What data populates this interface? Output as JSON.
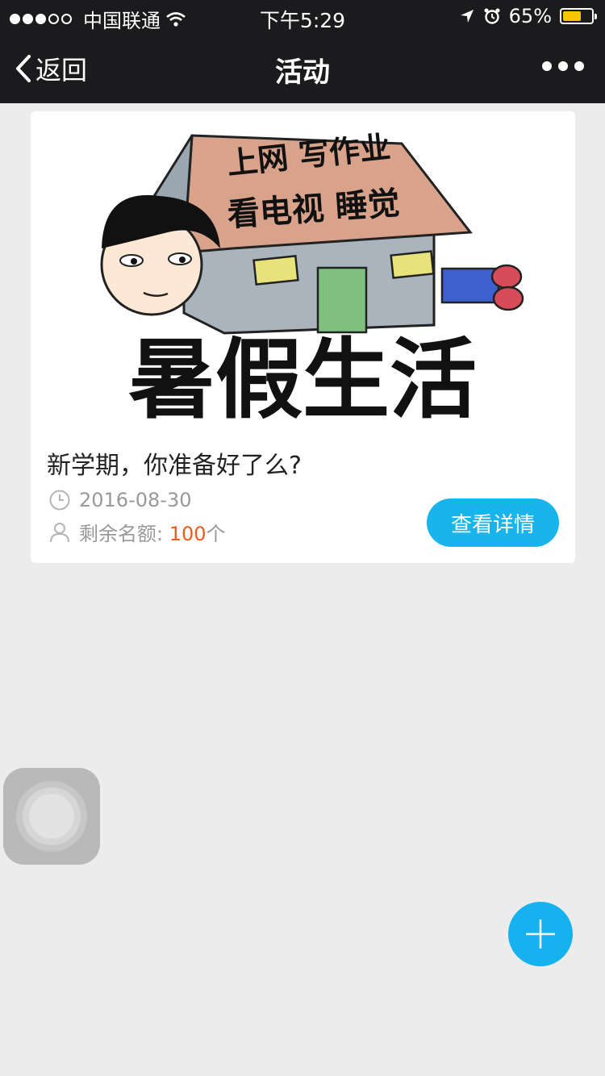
{
  "status_bar": {
    "carrier": "中国联通",
    "time": "下午5:29",
    "battery_percent": "65%",
    "battery_level": 0.65,
    "battery_color": "#f7c600"
  },
  "nav": {
    "back_label": "返回",
    "title": "活动",
    "more_icon": "more-icon"
  },
  "activity_card": {
    "banner": {
      "roof_text_line1": "上网 写作业",
      "roof_text_line2": "看电视 睡觉",
      "headline": "暑假生活"
    },
    "title": "新学期，你准备好了么?",
    "date": "2016-08-30",
    "quota_label": "剩余名额: ",
    "quota_value": "100",
    "quota_unit": "个",
    "detail_button": "查看详情",
    "accent_color": "#18b4ee",
    "quota_color": "#f05a1c"
  },
  "floating": {
    "assistive_touch": "assistive-touch-icon",
    "add_button": "plus-icon"
  }
}
